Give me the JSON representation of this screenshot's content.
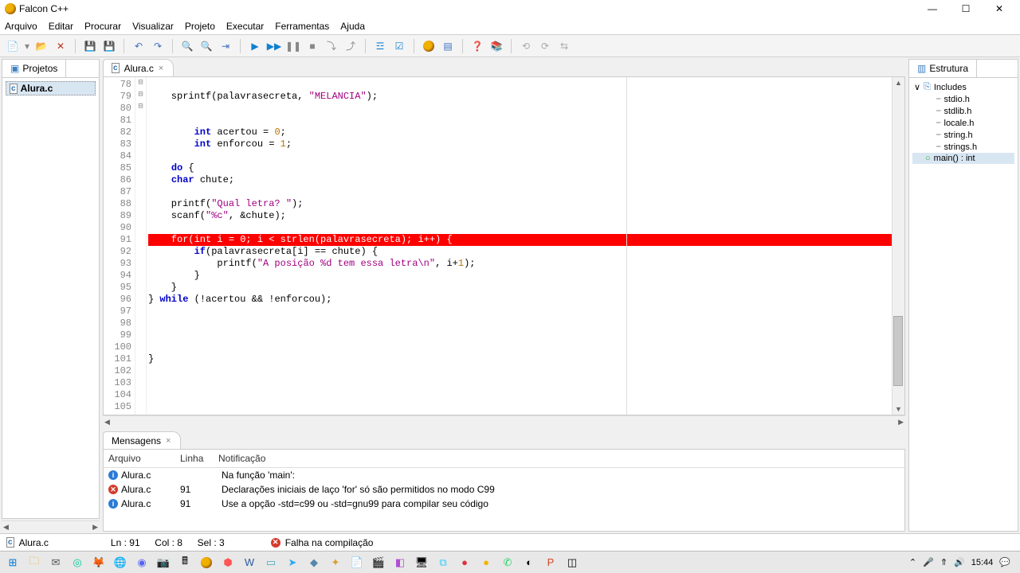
{
  "app": {
    "title": "Falcon C++"
  },
  "menu": {
    "items": [
      "Arquivo",
      "Editar",
      "Procurar",
      "Visualizar",
      "Projeto",
      "Executar",
      "Ferramentas",
      "Ajuda"
    ]
  },
  "project_panel": {
    "title": "Projetos",
    "file": "Alura.c"
  },
  "editor": {
    "tab_label": "Alura.c",
    "first_line_no": 78,
    "lines": [
      "",
      "    sprintf(palavrasecreta, \"MELANCIA\");",
      "",
      "",
      "        int acertou = 0;",
      "        int enforcou = 1;",
      "",
      "    do {",
      "    char chute;",
      "",
      "    printf(\"Qual letra? \");",
      "    scanf(\"%c\", &chute);",
      "",
      "    for(int i = 0; i < strlen(palavrasecreta); i++) {",
      "        if(palavrasecreta[i] == chute) {",
      "            printf(\"A posição %d tem essa letra\\n\", i+1);",
      "        }",
      "    }",
      "} while (!acertou && !enforcou);",
      "",
      "",
      "",
      "",
      "}",
      "",
      "",
      "",
      ""
    ],
    "error_line_index": 13,
    "fold_markers": {
      "7": "⊟",
      "13": "⊟",
      "14": "⊟"
    }
  },
  "messages": {
    "title": "Mensagens",
    "columns": [
      "Arquivo",
      "Linha",
      "Notificação"
    ],
    "rows": [
      {
        "icon": "info",
        "file": "Alura.c",
        "line": "",
        "note": "Na função 'main':"
      },
      {
        "icon": "error",
        "file": "Alura.c",
        "line": "91",
        "note": "Declarações iniciais de laço 'for' só são permitidos no modo C99"
      },
      {
        "icon": "info",
        "file": "Alura.c",
        "line": "91",
        "note": "Use a opção -std=c99 ou -std=gnu99 para compilar seu código"
      }
    ]
  },
  "structure": {
    "title": "Estrutura",
    "root": "Includes",
    "includes": [
      "stdio.h",
      "stdlib.h",
      "locale.h",
      "string.h",
      "strings.h"
    ],
    "main_fn": "main() : int"
  },
  "status": {
    "file": "Alura.c",
    "line_label": "Ln : 91",
    "col_label": "Col : 8",
    "sel_label": "Sel : 3",
    "compile_msg": "Falha na compilação"
  },
  "tray": {
    "time": "15:44"
  }
}
